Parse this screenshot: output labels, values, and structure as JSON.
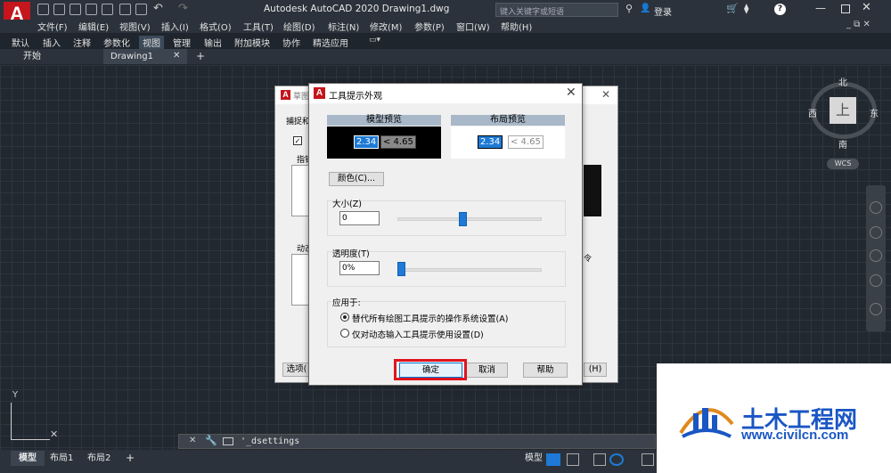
{
  "app": {
    "title": "Autodesk AutoCAD 2020    Drawing1.dwg",
    "logo": "A",
    "search_placeholder": "键入关键字或短语",
    "login": "登录",
    "help": "?"
  },
  "menu": [
    "文件(F)",
    "编辑(E)",
    "视图(V)",
    "插入(I)",
    "格式(O)",
    "工具(T)",
    "绘图(D)",
    "标注(N)",
    "修改(M)",
    "参数(P)",
    "窗口(W)",
    "帮助(H)"
  ],
  "ribbon_tabs": [
    "默认",
    "插入",
    "注释",
    "参数化",
    "视图",
    "管理",
    "输出",
    "附加模块",
    "协作",
    "精选应用"
  ],
  "ribbon_active": "视图",
  "doc_tabs": {
    "start": "开始",
    "drawing": "Drawing1",
    "close": "✕",
    "add": "+"
  },
  "viewcube": {
    "north": "北",
    "south": "南",
    "west": "西",
    "east": "东",
    "face": "上",
    "wcs": "WCS"
  },
  "back_dialog": {
    "title": "草图",
    "snap_label": "捕捉和",
    "pointer": "指针",
    "dynamic": "动态",
    "options_btn": "选项(",
    "help_btn": "(H)",
    "cmd": "令",
    "icon": "A",
    "close": "✕"
  },
  "dialog": {
    "title": "工具提示外观",
    "icon": "A",
    "close": "✕",
    "model_preview": {
      "header": "模型预览",
      "value1": "2.34",
      "value2": "< 4.65"
    },
    "layout_preview": {
      "header": "布局预览",
      "value1": "2.34",
      "value2": "< 4.65"
    },
    "color_button": "颜色(C)...",
    "size": {
      "label": "大小(Z)",
      "value": "0",
      "slider_fraction": 0.45
    },
    "transparency": {
      "label": "透明度(T)",
      "value": "0%",
      "slider_fraction": 0.0
    },
    "apply_to": {
      "label": "应用于:",
      "option1": "替代所有绘图工具提示的操作系统设置(A)",
      "option2": "仅对动态输入工具提示使用设置(D)",
      "selected": 1
    },
    "ok": "确定",
    "cancel": "取消",
    "help": "帮助"
  },
  "command_line": {
    "text": "'_dsettings",
    "close": "✕"
  },
  "status": {
    "tabs": [
      "模型",
      "布局1",
      "布局2"
    ],
    "add": "+",
    "model_right": "模型"
  },
  "watermark": {
    "title": "土木工程网",
    "url": "www.civilcn.com"
  },
  "colors": {
    "accent": "#1e7ad6",
    "highlight": "#e0141e",
    "brand": "#c4161c",
    "watermark": "#1a56c4"
  }
}
